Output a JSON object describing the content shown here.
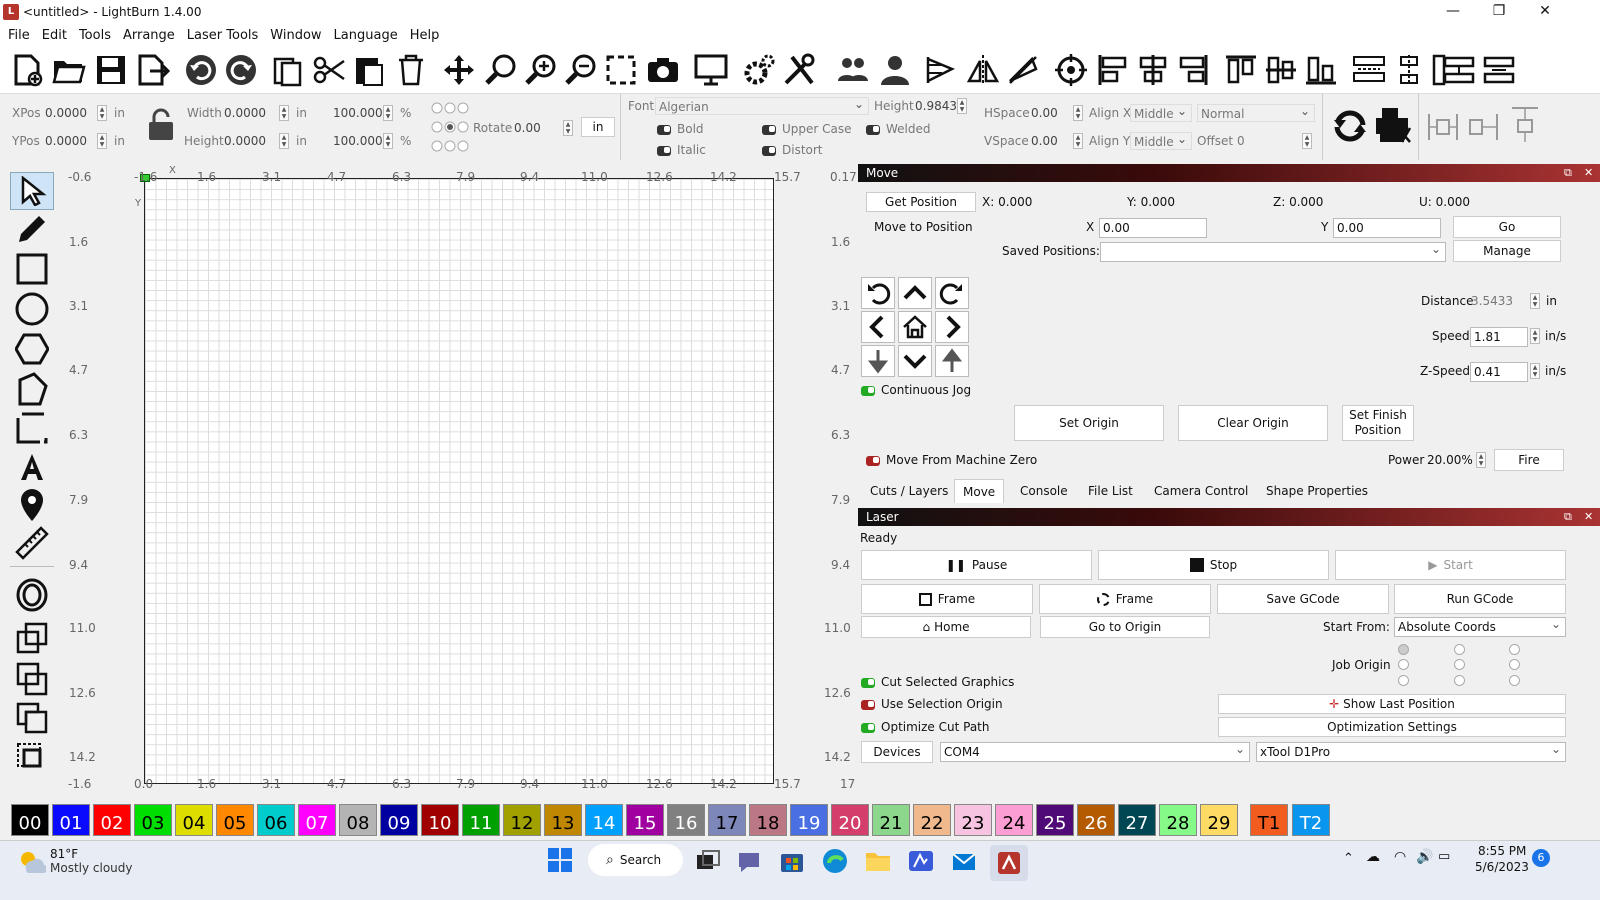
{
  "window": {
    "title": "<untitled> - LightBurn 1.4.00",
    "min": "—",
    "max": "❐",
    "close": "✕"
  },
  "menu": [
    "File",
    "Edit",
    "Tools",
    "Arrange",
    "Laser Tools",
    "Window",
    "Language",
    "Help"
  ],
  "props": {
    "xpos_label": "XPos",
    "xpos": "0.0000",
    "ypos_label": "YPos",
    "ypos": "0.0000",
    "unit": "in",
    "width_label": "Width",
    "width": "0.0000",
    "height_label": "Height",
    "height": "0.0000",
    "scale_x": "100.000",
    "scale_y": "100.000",
    "pct": "%",
    "rotate_label": "Rotate",
    "rotate": "0.00",
    "rotate_unit": "in",
    "font_label": "Font",
    "font": "Algerian",
    "fheight_label": "Height",
    "fheight": "0.9843",
    "hspace_label": "HSpace",
    "hspace": "0.00",
    "vspace_label": "VSpace",
    "vspace": "0.00",
    "alignx_label": "Align X",
    "alignx": "Middle",
    "aligny_label": "Align Y",
    "aligny": "Middle",
    "mode": "Normal",
    "offset_label": "Offset",
    "offset": "0",
    "bold": "Bold",
    "italic": "Italic",
    "upper": "Upper Case",
    "distort": "Distort",
    "welded": "Welded"
  },
  "rulers": {
    "top": [
      "-1.6",
      "1.6",
      "3.1",
      "4.7",
      "6.3",
      "7.9",
      "9.4",
      "11.0",
      "12.6",
      "14.2",
      "15.7"
    ],
    "left": [
      "-0.6",
      "1.6",
      "3.1",
      "4.7",
      "6.3",
      "7.9",
      "9.4",
      "11.0",
      "12.6",
      "14.2"
    ],
    "right": [
      "0.17",
      "1.6",
      "3.1",
      "4.7",
      "6.3",
      "7.9",
      "9.4",
      "11.0",
      "12.6",
      "14.2"
    ],
    "bottom": [
      "0.0",
      "1.6",
      "3.1",
      "4.7",
      "6.3",
      "7.9",
      "9.4",
      "11.0",
      "12.6",
      "14.2",
      "15.7"
    ],
    "bottom_left": "-1.6",
    "bottom_right": "17",
    "x_axis": "X",
    "y_axis": "Y"
  },
  "move": {
    "title": "Move",
    "get_position": "Get Position",
    "x": "X: 0.000",
    "y": "Y: 0.000",
    "z": "Z: 0.000",
    "u": "U: 0.000",
    "move_to": "Move to Position",
    "mx_label": "X",
    "mx": "0.00",
    "my_label": "Y",
    "my": "0.00",
    "go": "Go",
    "saved_label": "Saved Positions:",
    "manage": "Manage",
    "distance_label": "Distance",
    "distance": "3.5433",
    "distance_unit": "in",
    "speed_label": "Speed",
    "speed": "1.81",
    "speed_unit": "in/s",
    "zspeed_label": "Z-Speed",
    "zspeed": "0.41",
    "zspeed_unit": "in/s",
    "continuous": "Continuous Jog",
    "set_origin": "Set Origin",
    "clear_origin": "Clear Origin",
    "set_finish": "Set Finish Position",
    "from_zero": "Move From Machine Zero",
    "power_label": "Power",
    "power": "20.00%",
    "fire": "Fire"
  },
  "tabs": [
    "Cuts / Layers",
    "Move",
    "Console",
    "File List",
    "Camera Control",
    "Shape Properties"
  ],
  "laser": {
    "title": "Laser",
    "status": "Ready",
    "pause": "Pause",
    "stop": "Stop",
    "start": "Start",
    "frame1": "Frame",
    "frame2": "Frame",
    "save_gcode": "Save GCode",
    "run_gcode": "Run GCode",
    "home": "Home",
    "go_origin": "Go to Origin",
    "start_from_label": "Start From:",
    "start_from": "Absolute Coords",
    "job_origin": "Job Origin",
    "cut_selected": "Cut Selected Graphics",
    "use_selection": "Use Selection Origin",
    "optimize": "Optimize Cut Path",
    "show_last": "Show Last Position",
    "opt_settings": "Optimization Settings",
    "devices": "Devices",
    "port": "COM4",
    "device": "xTool D1Pro"
  },
  "palette": [
    {
      "l": "00",
      "c": "#000000",
      "t": "#fff"
    },
    {
      "l": "01",
      "c": "#0a0aff",
      "t": "#fff"
    },
    {
      "l": "02",
      "c": "#ff0000",
      "t": "#fff"
    },
    {
      "l": "03",
      "c": "#00dd00",
      "t": "#000"
    },
    {
      "l": "04",
      "c": "#dddd00",
      "t": "#000"
    },
    {
      "l": "05",
      "c": "#ff8800",
      "t": "#000"
    },
    {
      "l": "06",
      "c": "#00cccc",
      "t": "#000"
    },
    {
      "l": "07",
      "c": "#ff00ff",
      "t": "#fff"
    },
    {
      "l": "08",
      "c": "#b4b4b4",
      "t": "#000"
    },
    {
      "l": "09",
      "c": "#0000a0",
      "t": "#fff"
    },
    {
      "l": "10",
      "c": "#a00000",
      "t": "#fff"
    },
    {
      "l": "11",
      "c": "#00a000",
      "t": "#fff"
    },
    {
      "l": "12",
      "c": "#a0a000",
      "t": "#000"
    },
    {
      "l": "13",
      "c": "#c08800",
      "t": "#000"
    },
    {
      "l": "14",
      "c": "#00a0ff",
      "t": "#fff"
    },
    {
      "l": "15",
      "c": "#a000a0",
      "t": "#fff"
    },
    {
      "l": "16",
      "c": "#808080",
      "t": "#fff"
    },
    {
      "l": "17",
      "c": "#7d87b9",
      "t": "#000"
    },
    {
      "l": "18",
      "c": "#bb7784",
      "t": "#000"
    },
    {
      "l": "19",
      "c": "#4a6fe3",
      "t": "#fff"
    },
    {
      "l": "20",
      "c": "#d33f6a",
      "t": "#fff"
    },
    {
      "l": "21",
      "c": "#8cd78c",
      "t": "#000"
    },
    {
      "l": "22",
      "c": "#f0b98d",
      "t": "#000"
    },
    {
      "l": "23",
      "c": "#f6c4e1",
      "t": "#000"
    },
    {
      "l": "24",
      "c": "#fa9ed4",
      "t": "#000"
    },
    {
      "l": "25",
      "c": "#500a78",
      "t": "#fff"
    },
    {
      "l": "26",
      "c": "#b45a00",
      "t": "#fff"
    },
    {
      "l": "27",
      "c": "#004754",
      "t": "#fff"
    },
    {
      "l": "28",
      "c": "#86fa88",
      "t": "#000"
    },
    {
      "l": "29",
      "c": "#ffdb66",
      "t": "#000"
    },
    {
      "l": "T1",
      "c": "#f35c1f",
      "t": "#000"
    },
    {
      "l": "T2",
      "c": "#0a95ef",
      "t": "#fff"
    }
  ],
  "taskbar": {
    "temp": "81°F",
    "weather": "Mostly cloudy",
    "search": "Search",
    "time": "8:55 PM",
    "date": "5/6/2023",
    "badge": "6"
  }
}
